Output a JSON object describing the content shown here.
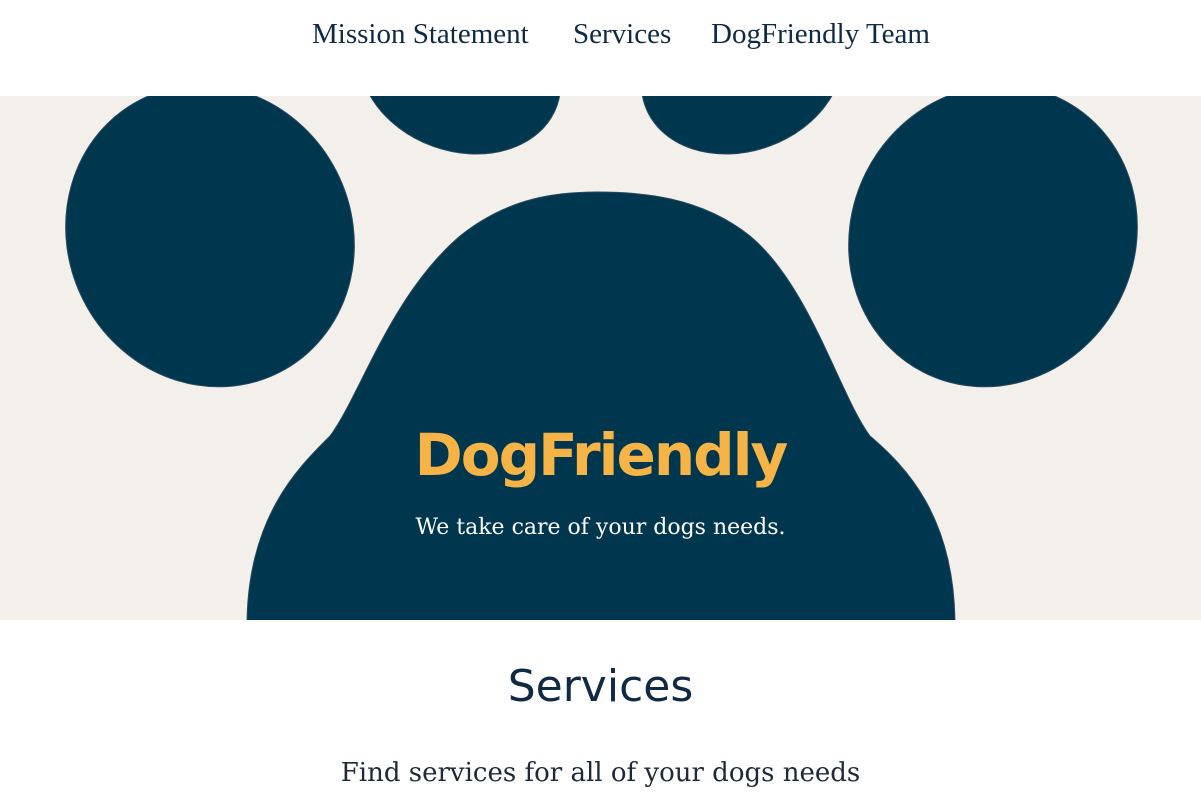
{
  "nav": {
    "items": [
      {
        "label": "Mission Statement"
      },
      {
        "label": "Services"
      },
      {
        "label": "DogFriendly Team"
      }
    ]
  },
  "hero": {
    "title": "DogFriendly",
    "subtitle": "We take care of your dogs needs.",
    "paw_icon": "paw-print-icon"
  },
  "services": {
    "heading": "Services",
    "description": "Find services for all of your dogs needs"
  },
  "colors": {
    "navy": "#00374f",
    "accent": "#f5b445",
    "hero_bg": "#f3f0ec",
    "text": "#0f2a44"
  }
}
